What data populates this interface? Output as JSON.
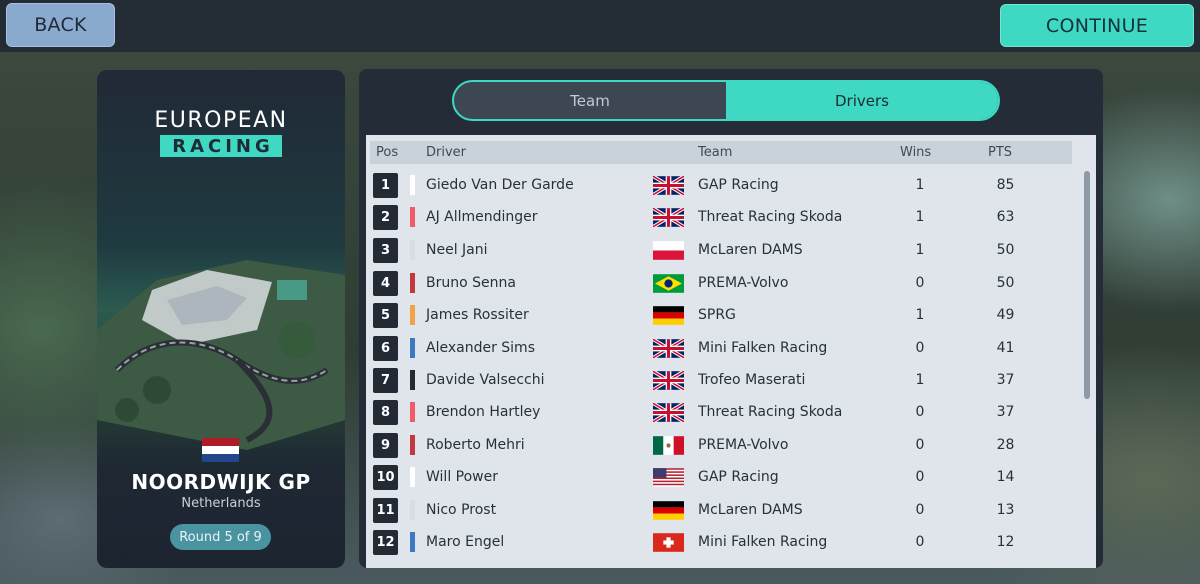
{
  "topbar": {
    "back_label": "BACK",
    "continue_label": "CONTINUE"
  },
  "event": {
    "series_line1": "EUROPEAN",
    "series_line2": "RACING",
    "name": "NOORDWIJK GP",
    "country": "Netherlands",
    "round": "Round 5 of 9",
    "flag_icon": "netherlands-flag-icon"
  },
  "tabs": [
    {
      "label": "Team",
      "active": false
    },
    {
      "label": "Drivers",
      "active": true
    }
  ],
  "columns": {
    "pos": "Pos",
    "driver": "Driver",
    "team": "Team",
    "wins": "Wins",
    "pts": "PTS"
  },
  "standings": [
    {
      "pos": "1",
      "driver": "Giedo Van Der Garde",
      "stripe": "#ffffff",
      "flag": "uk",
      "team": "GAP Racing",
      "wins": "1",
      "pts": "85"
    },
    {
      "pos": "2",
      "driver": "AJ Allmendinger",
      "stripe": "#f05a6a",
      "flag": "uk",
      "team": "Threat Racing Skoda",
      "wins": "1",
      "pts": "63"
    },
    {
      "pos": "3",
      "driver": "Neel Jani",
      "stripe": "#d8dde2",
      "flag": "poland",
      "team": "McLaren DAMS",
      "wins": "1",
      "pts": "50"
    },
    {
      "pos": "4",
      "driver": "Bruno Senna",
      "stripe": "#c0393f",
      "flag": "brazil",
      "team": "PREMA-Volvo",
      "wins": "0",
      "pts": "50"
    },
    {
      "pos": "5",
      "driver": "James Rossiter",
      "stripe": "#f2a24a",
      "flag": "germany",
      "team": "SPRG",
      "wins": "1",
      "pts": "49"
    },
    {
      "pos": "6",
      "driver": "Alexander Sims",
      "stripe": "#3e78c2",
      "flag": "uk",
      "team": "Mini Falken Racing",
      "wins": "0",
      "pts": "41"
    },
    {
      "pos": "7",
      "driver": "Davide Valsecchi",
      "stripe": "#232a34",
      "flag": "uk",
      "team": "Trofeo Maserati",
      "wins": "1",
      "pts": "37"
    },
    {
      "pos": "8",
      "driver": "Brendon Hartley",
      "stripe": "#f05a6a",
      "flag": "uk",
      "team": "Threat Racing Skoda",
      "wins": "0",
      "pts": "37"
    },
    {
      "pos": "9",
      "driver": "Roberto Mehri",
      "stripe": "#c0393f",
      "flag": "mexico",
      "team": "PREMA-Volvo",
      "wins": "0",
      "pts": "28"
    },
    {
      "pos": "10",
      "driver": "Will Power",
      "stripe": "#ffffff",
      "flag": "usa",
      "team": "GAP Racing",
      "wins": "0",
      "pts": "14"
    },
    {
      "pos": "11",
      "driver": "Nico Prost",
      "stripe": "#d8dde2",
      "flag": "germany",
      "team": "McLaren DAMS",
      "wins": "0",
      "pts": "13"
    },
    {
      "pos": "12",
      "driver": "Maro Engel",
      "stripe": "#3e78c2",
      "flag": "switzerland",
      "team": "Mini Falken Racing",
      "wins": "0",
      "pts": "12"
    }
  ],
  "colors": {
    "accent": "#3fd8c3",
    "back_button": "#8aa9cf",
    "panel": "#242c38",
    "table_bg": "#dfe5ea"
  }
}
